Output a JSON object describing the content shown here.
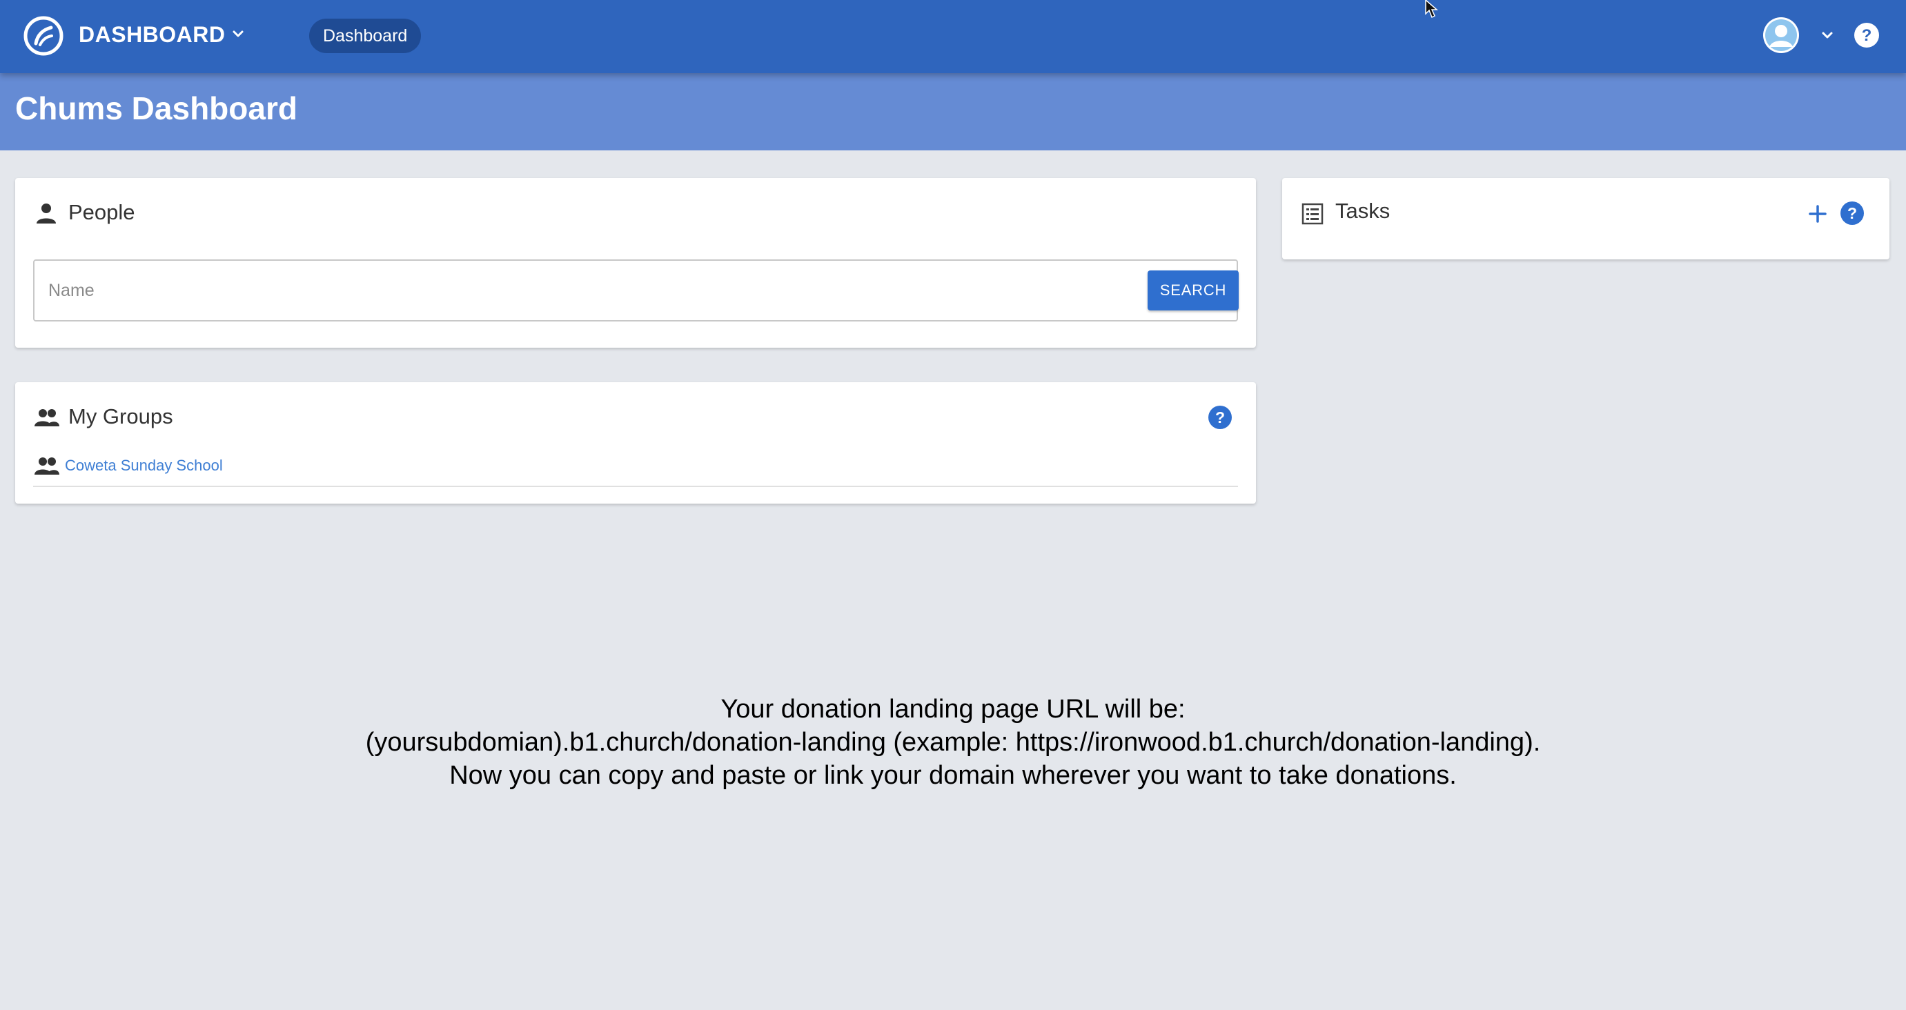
{
  "appbar": {
    "title": "DASHBOARD",
    "breadcrumb": "Dashboard"
  },
  "page": {
    "title": "Chums Dashboard"
  },
  "people": {
    "title": "People",
    "search_placeholder": "Name",
    "search_value": "",
    "search_button": "SEARCH"
  },
  "groups": {
    "title": "My Groups",
    "items": [
      {
        "name": "Coweta Sunday School"
      }
    ]
  },
  "tasks": {
    "title": "Tasks"
  },
  "caption": {
    "line1": "Your donation landing page URL will be:",
    "line2": "(yoursubdomian).b1.church/donation-landing (example: https://ironwood.b1.church/donation-landing).",
    "line3": "Now you can copy and paste or link your domain wherever you want to take donations."
  },
  "colors": {
    "appbar": "#2f65bd",
    "page_header": "#658bd4",
    "accent": "#2f6fcf",
    "background": "#e4e7ec"
  },
  "icons": {
    "logo": "b1-logo-icon",
    "people": "person-icon",
    "groups": "people-group-icon",
    "tasks": "list-icon",
    "add": "plus-icon",
    "help": "help-circle-icon",
    "user": "avatar-icon",
    "chevron": "chevron-down-icon"
  }
}
